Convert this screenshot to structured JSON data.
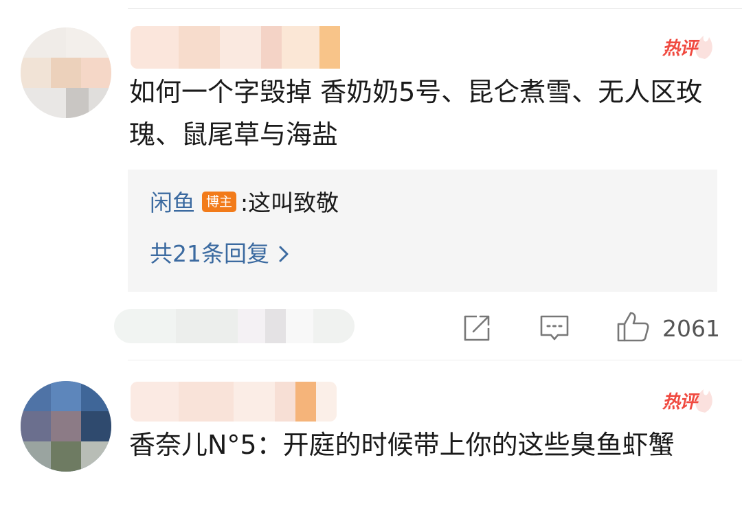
{
  "comments": [
    {
      "hot_label": "热评",
      "text": "如何一个字毁掉 香奶奶5号、昆仑煮雪、无人区玫瑰、鼠尾草与海盐",
      "reply": {
        "user": "闲鱼",
        "badge": "博主",
        "sep": ":",
        "text": "这叫致敬",
        "more": "共21条回复"
      },
      "like_count": "2061"
    },
    {
      "hot_label": "热评",
      "text": "香奈儿N°5：开庭的时候带上你的这些臭鱼虾蟹"
    }
  ],
  "icons": {
    "share": "share-icon",
    "comment": "comment-icon",
    "like": "thumbs-up-icon",
    "chevron": "chevron-right-icon"
  },
  "colors": {
    "hot": "#f04a40",
    "link": "#3b6aa0",
    "badge": "#f27b1a",
    "reply_bg": "#f5f5f5"
  }
}
